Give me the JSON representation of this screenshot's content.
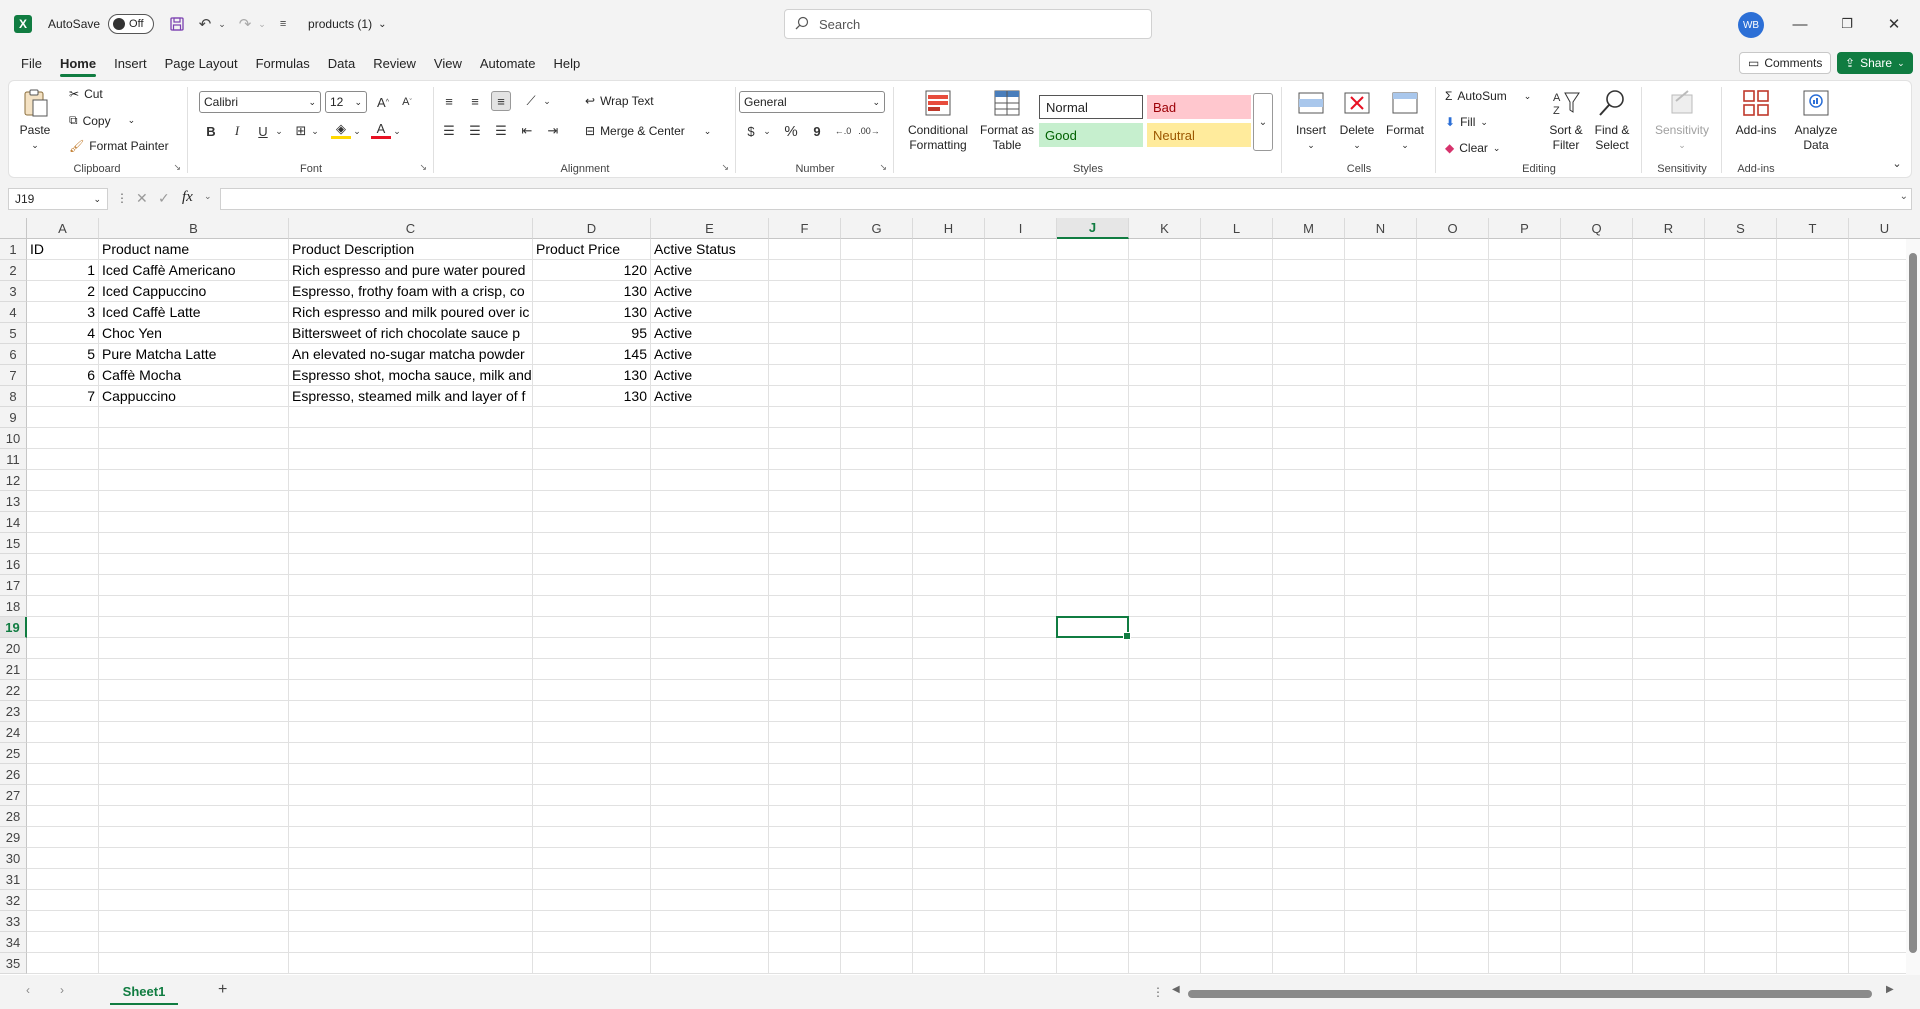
{
  "titlebar": {
    "app_logo": "X",
    "autosave_label": "AutoSave",
    "autosave_state": "Off",
    "filename": "products (1)",
    "search_placeholder": "Search",
    "user_initials": "WB"
  },
  "menu": {
    "tabs": [
      "File",
      "Home",
      "Insert",
      "Page Layout",
      "Formulas",
      "Data",
      "Review",
      "View",
      "Automate",
      "Help"
    ],
    "active_tab": "Home",
    "comments_label": "Comments",
    "share_label": "Share"
  },
  "ribbon": {
    "clipboard": {
      "label": "Clipboard",
      "paste": "Paste",
      "cut": "Cut",
      "copy": "Copy",
      "format_painter": "Format Painter"
    },
    "font": {
      "label": "Font",
      "font_name": "Calibri",
      "font_size": "12",
      "bold": "B",
      "italic": "I",
      "underline": "U"
    },
    "alignment": {
      "label": "Alignment",
      "wrap_text": "Wrap Text",
      "merge_center": "Merge & Center"
    },
    "number": {
      "label": "Number",
      "format": "General",
      "currency": "$",
      "percent": "%",
      "comma": "9"
    },
    "styles": {
      "label": "Styles",
      "conditional_formatting": [
        "Conditional",
        "Formatting"
      ],
      "format_as_table": [
        "Format as",
        "Table"
      ],
      "normal": "Normal",
      "bad": "Bad",
      "good": "Good",
      "neutral": "Neutral"
    },
    "cells": {
      "label": "Cells",
      "insert": "Insert",
      "delete": "Delete",
      "format": "Format"
    },
    "editing": {
      "label": "Editing",
      "autosum": "AutoSum",
      "fill": "Fill",
      "clear": "Clear",
      "sort_filter": [
        "Sort &",
        "Filter"
      ],
      "find_select": [
        "Find &",
        "Select"
      ]
    },
    "sensitivity": {
      "label": "Sensitivity",
      "button": "Sensitivity"
    },
    "addins": {
      "label": "Add-ins",
      "button": "Add-ins",
      "analyze": [
        "Analyze",
        "Data"
      ]
    }
  },
  "formula_bar": {
    "name_box": "J19",
    "fx": "fx",
    "content": ""
  },
  "sheet": {
    "columns": [
      "A",
      "B",
      "C",
      "D",
      "E",
      "F",
      "G",
      "H",
      "I",
      "J",
      "K",
      "L",
      "M",
      "N",
      "O",
      "P",
      "Q",
      "R",
      "S",
      "T",
      "U"
    ],
    "selected_column": "J",
    "selected_row": 19,
    "row_count": 35,
    "headers": [
      "ID",
      "Product name",
      "Product Description",
      "Product Price",
      "Active Status"
    ],
    "rows": [
      [
        "1",
        "Iced Caffè Americano",
        "Rich espresso and pure water poured",
        "120",
        "Active"
      ],
      [
        "2",
        "Iced Cappuccino",
        "Espresso, frothy foam with a crisp, co",
        "130",
        "Active"
      ],
      [
        "3",
        "Iced Caffè Latte",
        "Rich espresso and milk poured over ic",
        "130",
        "Active"
      ],
      [
        "4",
        "Choc Yen",
        "Bittersweet of rich chocolate sauce p",
        "95",
        "Active"
      ],
      [
        "5",
        "Pure Matcha Latte",
        "An elevated no-sugar matcha powder",
        "145",
        "Active"
      ],
      [
        "6",
        "Caffè Mocha",
        "Espresso shot, mocha sauce, milk and",
        "130",
        "Active"
      ],
      [
        "7",
        "Cappuccino",
        "Espresso, steamed milk and layer of f",
        "130",
        "Active"
      ]
    ]
  },
  "sheet_tabs": {
    "active": "Sheet1",
    "add": "+"
  }
}
